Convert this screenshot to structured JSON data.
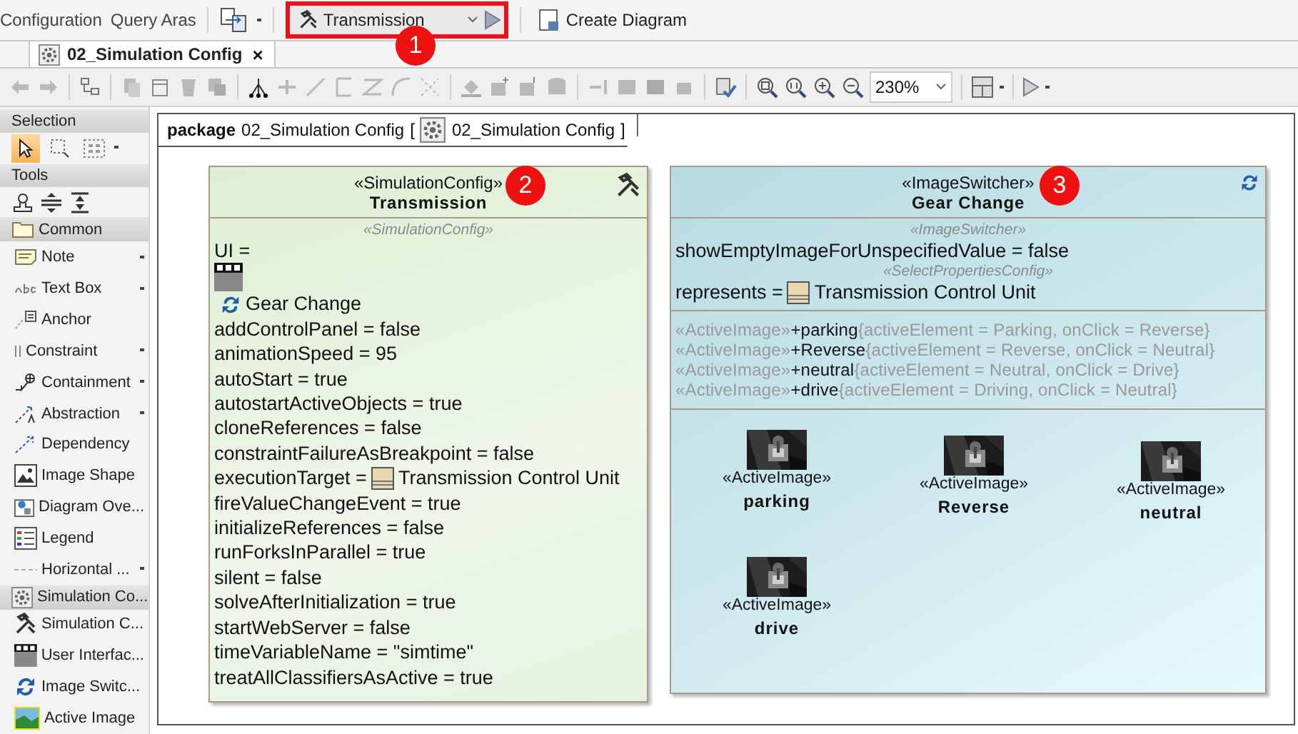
{
  "top_toolbar": {
    "menu_items": [
      "Configuration",
      "Query Aras"
    ],
    "config_select": {
      "value": "Transmission"
    },
    "create_button": "Create Diagram"
  },
  "callouts": [
    "1",
    "2",
    "3"
  ],
  "editor_tab": {
    "label": "02_Simulation Config",
    "close": "×"
  },
  "zoom_select": {
    "value": "230%"
  },
  "palette": {
    "selection": {
      "title": "Selection",
      "tools": [
        {
          "selected": true
        },
        {
          "selected": false
        },
        {
          "selected": false
        }
      ]
    },
    "tools_title": "Tools",
    "groups": [
      {
        "title": "Common",
        "items": [
          {
            "label": "Note",
            "has_menu": true
          },
          {
            "label": "Text Box",
            "has_menu": true
          },
          {
            "label": "Anchor",
            "has_menu": false
          },
          {
            "label": "Constraint",
            "has_menu": true
          },
          {
            "label": "Containment",
            "has_menu": true
          },
          {
            "label": "Abstraction",
            "has_menu": true
          },
          {
            "label": "Dependency",
            "has_menu": false
          },
          {
            "label": "Image Shape",
            "has_menu": false
          },
          {
            "label": "Diagram Ove...",
            "has_menu": false
          },
          {
            "label": "Legend",
            "has_menu": false
          },
          {
            "label": "Horizontal ...",
            "has_menu": true
          }
        ]
      },
      {
        "title": "Simulation Co...",
        "items": [
          {
            "label": "Simulation C...",
            "has_menu": false
          },
          {
            "label": "User Interfac...",
            "has_menu": false
          },
          {
            "label": "Image Switc...",
            "has_menu": false
          },
          {
            "label": "Active Image",
            "has_menu": false
          }
        ]
      }
    ]
  },
  "diagram": {
    "frame": {
      "keyword": "package",
      "name": "02_Simulation Config",
      "open": "[",
      "ref": "02_Simulation Config",
      "close": "]"
    },
    "config_block": {
      "stereotype": "«SimulationConfig»",
      "name": "Transmission",
      "compartment_stereotype": "«SimulationConfig»",
      "properties": [
        {
          "kind": "ui",
          "text": "UI =",
          "ref": "Gear Change"
        },
        {
          "kind": "plain",
          "text": "addControlPanel = false"
        },
        {
          "kind": "plain",
          "text": "animationSpeed = 95"
        },
        {
          "kind": "plain",
          "text": "autoStart = true"
        },
        {
          "kind": "plain",
          "text": "autostartActiveObjects = true"
        },
        {
          "kind": "plain",
          "text": "cloneReferences = false"
        },
        {
          "kind": "plain",
          "text": "constraintFailureAsBreakpoint = false"
        },
        {
          "kind": "ref",
          "text": "executionTarget =",
          "ref": "Transmission Control Unit"
        },
        {
          "kind": "plain",
          "text": "fireValueChangeEvent = true"
        },
        {
          "kind": "plain",
          "text": "initializeReferences = false"
        },
        {
          "kind": "plain",
          "text": "runForksInParallel = true"
        },
        {
          "kind": "plain",
          "text": "silent = false"
        },
        {
          "kind": "plain",
          "text": "solveAfterInitialization = true"
        },
        {
          "kind": "plain",
          "text": "startWebServer = false"
        },
        {
          "kind": "plain",
          "text": "timeVariableName = \"simtime\""
        },
        {
          "kind": "plain",
          "text": "treatAllClassifiersAsActive = true"
        }
      ]
    },
    "switcher_block": {
      "stereotype": "«ImageSwitcher»",
      "name": "Gear Change",
      "properties": [
        {
          "kind": "stereotype",
          "text": "«ImageSwitcher»"
        },
        {
          "kind": "plain",
          "text": "showEmptyImageForUnspecifiedValue = false"
        },
        {
          "kind": "stereotype",
          "text": "«SelectPropertiesConfig»"
        },
        {
          "kind": "ref",
          "text": "represents =",
          "ref": "Transmission Control Unit"
        }
      ],
      "parts": [
        {
          "stereotype": "«ActiveImage»",
          "name": "+parking",
          "constraint": "{activeElement = Parking, onClick = Reverse}"
        },
        {
          "stereotype": "«ActiveImage»",
          "name": "+Reverse",
          "constraint": "{activeElement = Reverse, onClick = Neutral}"
        },
        {
          "stereotype": "«ActiveImage»",
          "name": "+neutral",
          "constraint": "{activeElement = Neutral, onClick = Drive}"
        },
        {
          "stereotype": "«ActiveImage»",
          "name": "+drive",
          "constraint": "{activeElement = Driving, onClick = Neutral}"
        }
      ],
      "images": [
        {
          "stereotype": "«ActiveImage»",
          "name": "parking"
        },
        {
          "stereotype": "«ActiveImage»",
          "name": "Reverse"
        },
        {
          "stereotype": "«ActiveImage»",
          "name": "neutral"
        },
        {
          "stereotype": "«ActiveImage»",
          "name": "drive"
        }
      ]
    }
  }
}
